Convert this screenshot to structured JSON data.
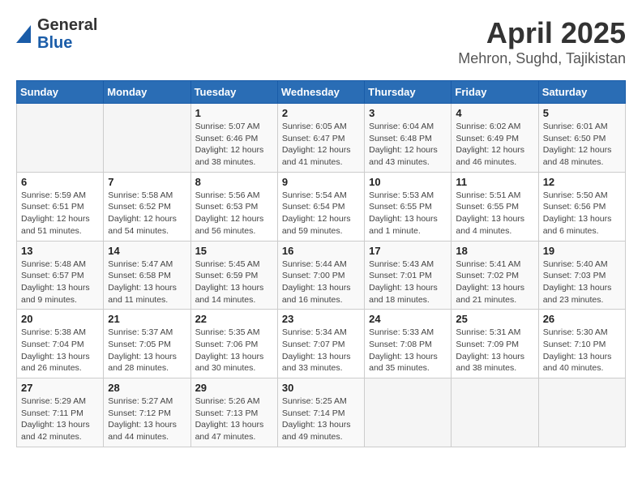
{
  "header": {
    "logo_line1": "General",
    "logo_line2": "Blue",
    "title": "April 2025",
    "subtitle": "Mehron, Sughd, Tajikistan"
  },
  "calendar": {
    "weekdays": [
      "Sunday",
      "Monday",
      "Tuesday",
      "Wednesday",
      "Thursday",
      "Friday",
      "Saturday"
    ],
    "weeks": [
      [
        {
          "day": "",
          "info": ""
        },
        {
          "day": "",
          "info": ""
        },
        {
          "day": "1",
          "sunrise": "5:07 AM",
          "sunset": "6:46 PM",
          "daylight": "12 hours and 38 minutes."
        },
        {
          "day": "2",
          "sunrise": "6:05 AM",
          "sunset": "6:47 PM",
          "daylight": "12 hours and 41 minutes."
        },
        {
          "day": "3",
          "sunrise": "6:04 AM",
          "sunset": "6:48 PM",
          "daylight": "12 hours and 43 minutes."
        },
        {
          "day": "4",
          "sunrise": "6:02 AM",
          "sunset": "6:49 PM",
          "daylight": "12 hours and 46 minutes."
        },
        {
          "day": "5",
          "sunrise": "6:01 AM",
          "sunset": "6:50 PM",
          "daylight": "12 hours and 48 minutes."
        }
      ],
      [
        {
          "day": "6",
          "sunrise": "5:59 AM",
          "sunset": "6:51 PM",
          "daylight": "12 hours and 51 minutes."
        },
        {
          "day": "7",
          "sunrise": "5:58 AM",
          "sunset": "6:52 PM",
          "daylight": "12 hours and 54 minutes."
        },
        {
          "day": "8",
          "sunrise": "5:56 AM",
          "sunset": "6:53 PM",
          "daylight": "12 hours and 56 minutes."
        },
        {
          "day": "9",
          "sunrise": "5:54 AM",
          "sunset": "6:54 PM",
          "daylight": "12 hours and 59 minutes."
        },
        {
          "day": "10",
          "sunrise": "5:53 AM",
          "sunset": "6:55 PM",
          "daylight": "13 hours and 1 minute."
        },
        {
          "day": "11",
          "sunrise": "5:51 AM",
          "sunset": "6:55 PM",
          "daylight": "13 hours and 4 minutes."
        },
        {
          "day": "12",
          "sunrise": "5:50 AM",
          "sunset": "6:56 PM",
          "daylight": "13 hours and 6 minutes."
        }
      ],
      [
        {
          "day": "13",
          "sunrise": "5:48 AM",
          "sunset": "6:57 PM",
          "daylight": "13 hours and 9 minutes."
        },
        {
          "day": "14",
          "sunrise": "5:47 AM",
          "sunset": "6:58 PM",
          "daylight": "13 hours and 11 minutes."
        },
        {
          "day": "15",
          "sunrise": "5:45 AM",
          "sunset": "6:59 PM",
          "daylight": "13 hours and 14 minutes."
        },
        {
          "day": "16",
          "sunrise": "5:44 AM",
          "sunset": "7:00 PM",
          "daylight": "13 hours and 16 minutes."
        },
        {
          "day": "17",
          "sunrise": "5:43 AM",
          "sunset": "7:01 PM",
          "daylight": "13 hours and 18 minutes."
        },
        {
          "day": "18",
          "sunrise": "5:41 AM",
          "sunset": "7:02 PM",
          "daylight": "13 hours and 21 minutes."
        },
        {
          "day": "19",
          "sunrise": "5:40 AM",
          "sunset": "7:03 PM",
          "daylight": "13 hours and 23 minutes."
        }
      ],
      [
        {
          "day": "20",
          "sunrise": "5:38 AM",
          "sunset": "7:04 PM",
          "daylight": "13 hours and 26 minutes."
        },
        {
          "day": "21",
          "sunrise": "5:37 AM",
          "sunset": "7:05 PM",
          "daylight": "13 hours and 28 minutes."
        },
        {
          "day": "22",
          "sunrise": "5:35 AM",
          "sunset": "7:06 PM",
          "daylight": "13 hours and 30 minutes."
        },
        {
          "day": "23",
          "sunrise": "5:34 AM",
          "sunset": "7:07 PM",
          "daylight": "13 hours and 33 minutes."
        },
        {
          "day": "24",
          "sunrise": "5:33 AM",
          "sunset": "7:08 PM",
          "daylight": "13 hours and 35 minutes."
        },
        {
          "day": "25",
          "sunrise": "5:31 AM",
          "sunset": "7:09 PM",
          "daylight": "13 hours and 38 minutes."
        },
        {
          "day": "26",
          "sunrise": "5:30 AM",
          "sunset": "7:10 PM",
          "daylight": "13 hours and 40 minutes."
        }
      ],
      [
        {
          "day": "27",
          "sunrise": "5:29 AM",
          "sunset": "7:11 PM",
          "daylight": "13 hours and 42 minutes."
        },
        {
          "day": "28",
          "sunrise": "5:27 AM",
          "sunset": "7:12 PM",
          "daylight": "13 hours and 44 minutes."
        },
        {
          "day": "29",
          "sunrise": "5:26 AM",
          "sunset": "7:13 PM",
          "daylight": "13 hours and 47 minutes."
        },
        {
          "day": "30",
          "sunrise": "5:25 AM",
          "sunset": "7:14 PM",
          "daylight": "13 hours and 49 minutes."
        },
        {
          "day": "",
          "info": ""
        },
        {
          "day": "",
          "info": ""
        },
        {
          "day": "",
          "info": ""
        }
      ]
    ]
  }
}
